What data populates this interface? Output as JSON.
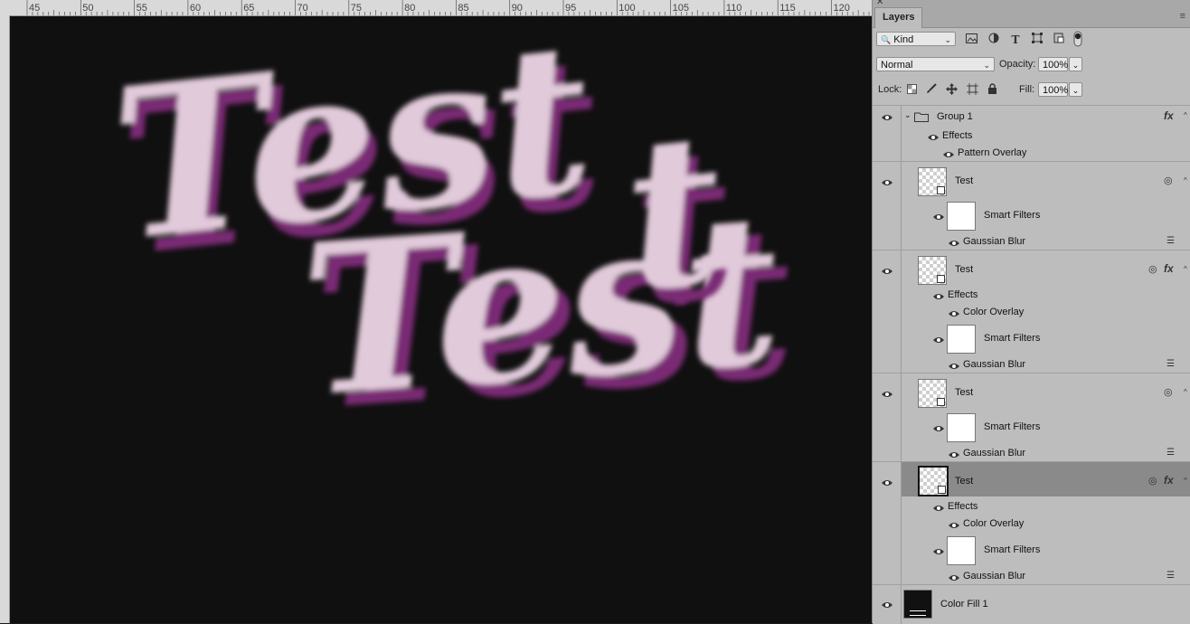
{
  "ruler": {
    "ticks": [
      "45",
      "50",
      "55",
      "60",
      "65",
      "70",
      "75",
      "80",
      "85",
      "90",
      "95",
      "100",
      "105",
      "110",
      "115",
      "120"
    ]
  },
  "canvas": {
    "text": "Test",
    "colors": {
      "background": "#101010",
      "fill": "#e8cde0",
      "shadow": "#7a2a74"
    }
  },
  "panel": {
    "close_glyph": "✕",
    "tab": "Layers",
    "menu_glyph": "≡",
    "filter": {
      "kind_label": "Kind",
      "search_glyph": "🔍"
    },
    "blend": {
      "mode": "Normal",
      "opacity_label": "Opacity:",
      "opacity": "100%"
    },
    "lock": {
      "label": "Lock:",
      "fill_label": "Fill:",
      "fill": "100%"
    },
    "layers": {
      "group1": {
        "name": "Group 1",
        "effects": "Effects",
        "pattern_overlay": "Pattern Overlay",
        "fx": "fx"
      },
      "test1": {
        "name": "Test",
        "smart_filters": "Smart Filters",
        "gaussian_blur": "Gaussian Blur"
      },
      "test2": {
        "name": "Test",
        "effects": "Effects",
        "color_overlay": "Color Overlay",
        "smart_filters": "Smart Filters",
        "gaussian_blur": "Gaussian Blur",
        "fx": "fx"
      },
      "test3": {
        "name": "Test",
        "smart_filters": "Smart Filters",
        "gaussian_blur": "Gaussian Blur"
      },
      "test4": {
        "name": "Test",
        "effects": "Effects",
        "color_overlay": "Color Overlay",
        "smart_filters": "Smart Filters",
        "gaussian_blur": "Gaussian Blur",
        "fx": "fx"
      },
      "colorfill": {
        "name": "Color Fill 1"
      }
    }
  }
}
